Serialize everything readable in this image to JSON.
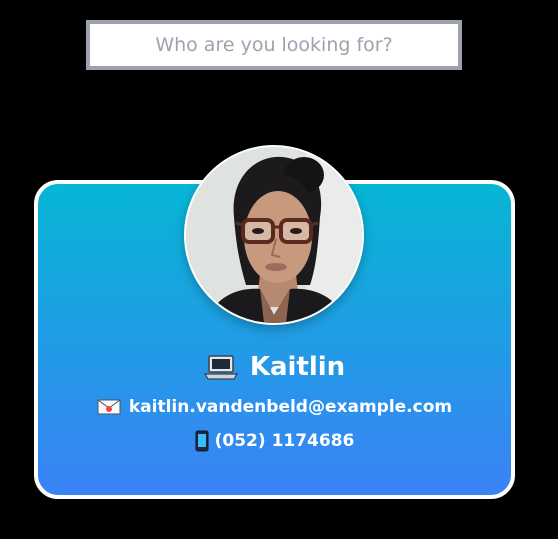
{
  "search": {
    "placeholder": "Who are you looking for?",
    "value": ""
  },
  "profile": {
    "name": "Kaitlin",
    "email": "kaitlin.vandenbeld@example.com",
    "phone": "(052) 1174686",
    "icons": {
      "name": "laptop-icon",
      "email": "envelope-icon",
      "phone": "mobile-phone-icon"
    }
  },
  "colors": {
    "background": "#000000",
    "search_border": "#9ca3af",
    "card_gradient_top": "#06b6d4",
    "card_gradient_bottom": "#3b82f6",
    "card_border": "#ffffff",
    "text": "#ffffff"
  }
}
